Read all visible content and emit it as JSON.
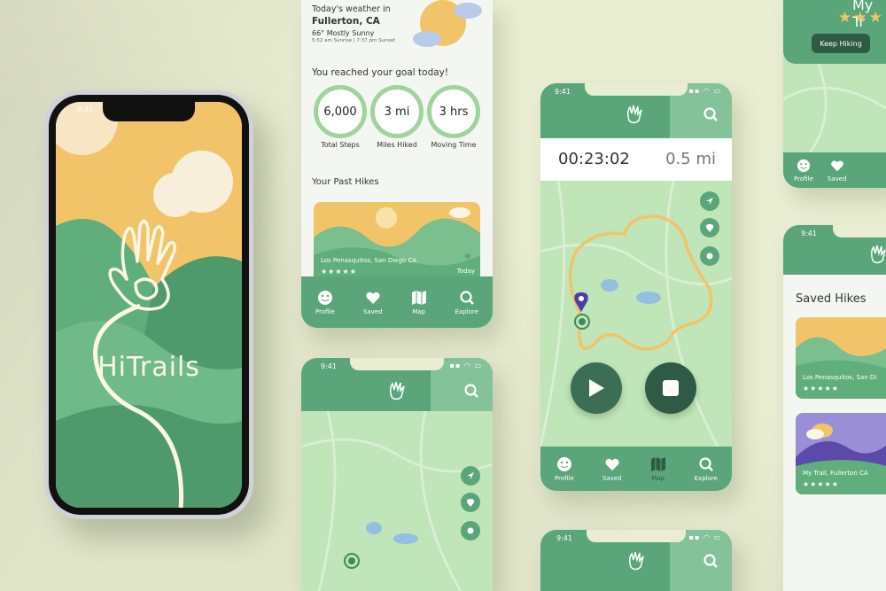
{
  "phone": {
    "status_time": "9:41",
    "app_name": "HiTrails"
  },
  "weather_screen": {
    "heading": "Today's weather in",
    "location": "Fullerton, CA",
    "condition": "66° Mostly Sunny",
    "sun_times": "5:52 am Sunrise | 7:37 pm Sunset",
    "goal_heading": "You reached your goal today!",
    "stats": [
      {
        "value": "6,000",
        "label": "Total Steps"
      },
      {
        "value": "3 mi",
        "label": "Miles Hiked"
      },
      {
        "value": "3 hrs",
        "label": "Moving Time"
      }
    ],
    "past_hikes_heading": "Your Past Hikes",
    "past_hike": {
      "name": "Los Penasquitos, San Diego CA",
      "date": "Today",
      "rating": "★★★★★"
    }
  },
  "tabs": [
    {
      "label": "Profile",
      "icon": "smiley-icon"
    },
    {
      "label": "Saved",
      "icon": "heart-icon"
    },
    {
      "label": "Map",
      "icon": "map-icon"
    },
    {
      "label": "Explore",
      "icon": "search-icon"
    }
  ],
  "map_screen_small": {
    "status_time": "9:41"
  },
  "tracking_screen": {
    "status_time": "9:41",
    "timer": "00:23:02",
    "distance": "0.5 mi"
  },
  "bottom_screen": {
    "status_time": "9:41"
  },
  "review_screen": {
    "title_fragment": "My Tr",
    "rating": "★★★",
    "button": "Keep Hiking"
  },
  "saved_screen": {
    "status_time": "9:41",
    "heading": "Saved Hikes",
    "items": [
      {
        "name": "Los Penasquitos, San Di",
        "rating": "★★★★★"
      },
      {
        "name": "My Trail, Fullerton CA",
        "rating": "★★★★★"
      }
    ]
  },
  "colors": {
    "brand_green": "#5ba57a",
    "light_green": "#bfe5b8",
    "sun_yellow": "#f2c46a",
    "background": "#e9edd1"
  }
}
